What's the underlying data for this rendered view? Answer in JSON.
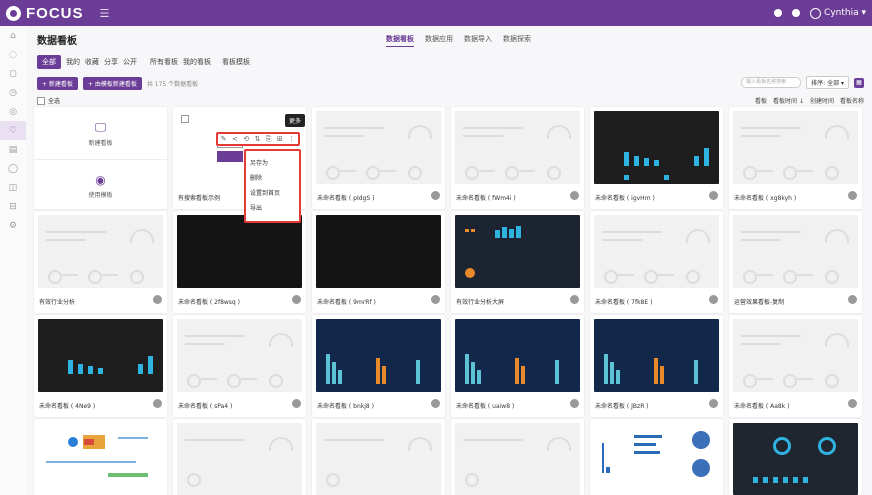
{
  "app": {
    "brand": "FOCUS",
    "menu_icon": "☰",
    "user_label": "Cynthia ▾"
  },
  "main": {
    "page_title": "数据看板"
  },
  "subnav": [
    "数据看板",
    "数据应用",
    "数据导入",
    "数据探索"
  ],
  "cat_tabs": [
    "全部",
    "我的",
    "收藏",
    "分享",
    "公开",
    "所有看板",
    "我的看板",
    "看板模板"
  ],
  "actions": {
    "new_board": "+ 新建看板",
    "new_from_template": "+ 由模板新建看板",
    "hint": "共 175 个数据看板"
  },
  "toolbar_right": {
    "search_placeholder": "输入看板名称搜索",
    "sort": "排序: 全部 ▾",
    "grid": "▦"
  },
  "select_all": "全选",
  "sort_links": [
    "看板",
    "看板时间 ↓",
    "创建时间",
    "看板名称"
  ],
  "tooltip": "更多",
  "iconbar": [
    "✎",
    "<",
    "⟲",
    "⇅",
    "⎘",
    "⊞",
    "⋮"
  ],
  "popmenu": [
    "另存为",
    "删除",
    "设置到首页",
    "导出"
  ],
  "new_tiles": {
    "add_board": "新建看板",
    "add_template": "使用模板"
  },
  "cards": [
    "有搜索看板示例",
    "未命名看板 ( pIdgS )",
    "未命名看板 ( fWm4i )",
    "未命名看板 ( igvHm )",
    "未命名看板 ( xg8kyh )",
    "有效行业分析",
    "未命名看板 ( 2f8wsq )",
    "未命名看板 ( 9mrRf )",
    "有效行业分析大屏",
    "未命名看板 ( 7fk8E )",
    "运营效果看板-复制",
    "未命名看板 ( 4Ne9 )",
    "未命名看板 ( sPa4 )",
    "未命名看板 ( bnkj8 )",
    "未命名看板 ( uaiw8 )",
    "未命名看板 ( JBzR )",
    "未命名看板 ( Aa8k )"
  ]
}
